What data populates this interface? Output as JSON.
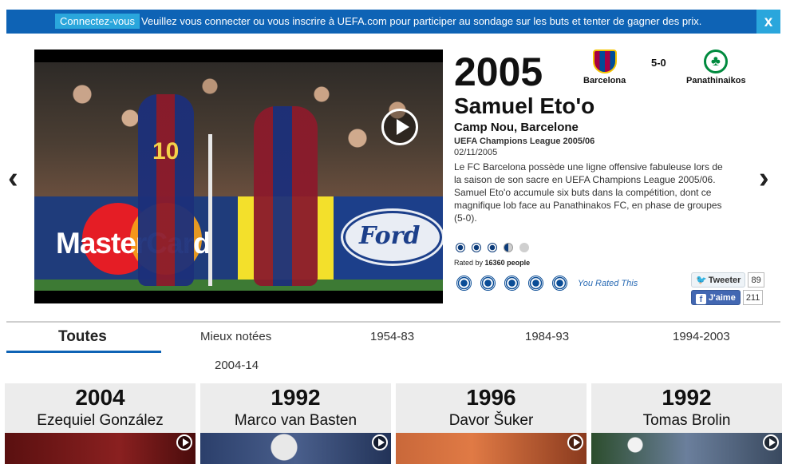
{
  "banner": {
    "login_label": "Connectez-vous",
    "message": "Veuillez vous connecter ou vous inscrire à UEFA.com pour participer au sondage sur les buts et tenter de gagner des prix.",
    "close_label": "x"
  },
  "nav": {
    "prev_label": "‹",
    "next_label": "›"
  },
  "goal": {
    "year": "2005",
    "home_team": "Barcelona",
    "away_team": "Panathinaikos",
    "score": "5-0",
    "scorer": "Samuel Eto'o",
    "venue": "Camp Nou, Barcelone",
    "competition": "UEFA Champions League 2005/06",
    "date": "02/11/2005",
    "description": "Le FC Barcelona possède une ligne offensive fabuleuse lors de la saison de son sacre en UEFA Champions League 2005/06. Samuel Eto'o accumule six buts dans la compétition, dont ce magnifique lob face au Panathinakos FC, en phase de groupes (5-0).",
    "rating": 3.5,
    "rating_max": 5,
    "rated_by_prefix": "Rated by",
    "rated_by_count": "16360 people",
    "you_rated": "You Rated This"
  },
  "video_ads": {
    "mastercard": "MasterCard",
    "ford": "Ford",
    "shirt_number": "10"
  },
  "social": {
    "tweet_label": "Tweeter",
    "tweet_count": "89",
    "like_label": "J'aime",
    "like_count": "211"
  },
  "tabs": [
    {
      "label": "Toutes"
    },
    {
      "label": "Mieux notées"
    },
    {
      "label": "1954-83"
    },
    {
      "label": "1984-93"
    },
    {
      "label": "1994-2003"
    },
    {
      "label": "2004-14"
    }
  ],
  "cards": [
    {
      "year": "2004",
      "name": "Ezequiel González"
    },
    {
      "year": "1992",
      "name": "Marco van Basten"
    },
    {
      "year": "1996",
      "name": "Davor Šuker"
    },
    {
      "year": "1992",
      "name": "Tomas Brolin"
    }
  ],
  "colors": {
    "uefa_blue": "#0e63b5",
    "banner_accent": "#2aa6dc"
  }
}
